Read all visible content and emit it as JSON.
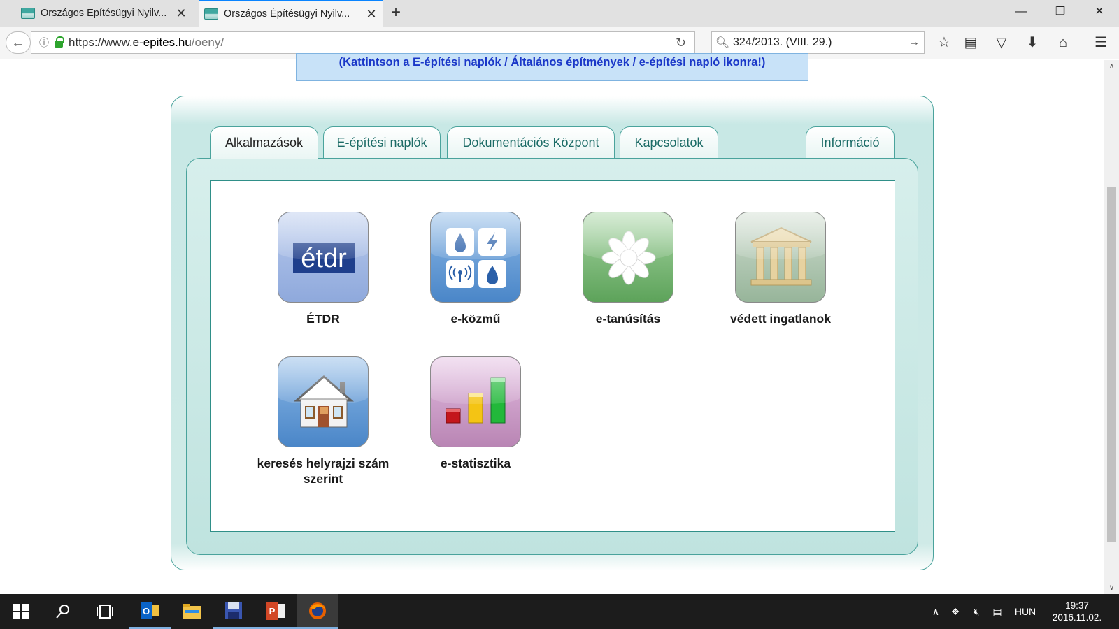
{
  "browser": {
    "tabs": [
      {
        "title": "Országos Építésügyi Nyilv...",
        "active": false
      },
      {
        "title": "Országos Építésügyi Nyilv...",
        "active": true
      }
    ],
    "new_tab_symbol": "+",
    "close_symbol": "✕",
    "window_controls": {
      "minimize": "—",
      "maximize": "❐",
      "close": "✕"
    },
    "url": {
      "scheme": "https://www.",
      "host": "e-epites.hu",
      "path": "/oeny/"
    },
    "search_value": "324/2013. (VIII. 29.)",
    "toolbar_icons": [
      "bookmark-star-icon",
      "reading-list-icon",
      "pocket-icon",
      "download-icon",
      "home-icon",
      "menu-icon"
    ]
  },
  "page": {
    "notice": "(Kattintson a E-építési naplók / Általános építmények / e-építési napló ikonra!)",
    "tabs": [
      {
        "label": "Alkalmazások",
        "active": true
      },
      {
        "label": "E-építési naplók",
        "active": false
      },
      {
        "label": "Dokumentációs Központ",
        "active": false
      },
      {
        "label": "Kapcsolatok",
        "active": false
      },
      {
        "label": "Információ",
        "active": false
      }
    ],
    "apps": [
      {
        "label": "ÉTDR",
        "icon": "etdr-logo-icon",
        "logo_text": "étdr",
        "color": "#8fa9dc"
      },
      {
        "label": "e-közmű",
        "icon": "utilities-grid-icon",
        "color": "#5d97d4"
      },
      {
        "label": "e-tanúsítás",
        "icon": "snowflake-asterisk-icon",
        "color": "#73b06f"
      },
      {
        "label": "védett ingatlanok",
        "icon": "classical-building-icon",
        "color": "#a9c2aa"
      },
      {
        "label": "keresés helyrajzi szám szerint",
        "icon": "house-icon",
        "color": "#5d97d4"
      },
      {
        "label": "e-statisztika",
        "icon": "bar-chart-icon",
        "color": "#c996c4"
      }
    ]
  },
  "taskbar": {
    "apps": [
      "outlook-icon",
      "file-explorer-icon",
      "save-disk-icon",
      "powerpoint-icon",
      "firefox-icon"
    ],
    "language": "HUN",
    "time": "19:37",
    "date": "2016.11.02."
  }
}
